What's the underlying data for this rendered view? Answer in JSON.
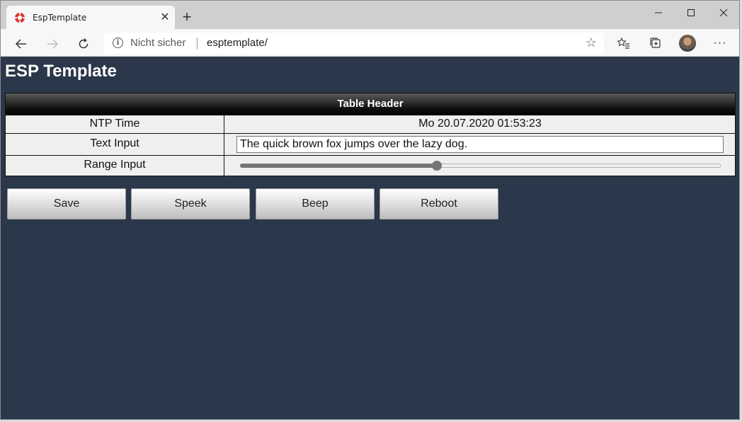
{
  "browser": {
    "tab_title": "EspTemplate",
    "tab_close": "✕",
    "new_tab": "+",
    "security_label": "Nicht sicher",
    "url": "esptemplate/",
    "icons": [
      "favicon-icon",
      "close-icon",
      "plus-icon",
      "minimize-icon",
      "maximize-icon",
      "close-window-icon",
      "back-icon",
      "forward-icon",
      "reload-icon",
      "info-icon",
      "star-icon",
      "favorites-icon",
      "collections-icon",
      "profile-icon",
      "more-icon"
    ]
  },
  "page": {
    "title": "ESP Template",
    "table": {
      "header": "Table Header",
      "rows": [
        {
          "label": "NTP Time",
          "value": "Mo 20.07.2020 01:53:23"
        },
        {
          "label": "Text Input",
          "value": "The quick brown fox jumps over the lazy dog."
        },
        {
          "label": "Range Input",
          "value": 0.41
        }
      ]
    },
    "buttons": [
      "Save",
      "Speek",
      "Beep",
      "Reboot"
    ]
  },
  "colors": {
    "page_background": "#2b374a",
    "header_background": "#000000",
    "table_background": "#efefef",
    "favicon": "#d9342b"
  }
}
